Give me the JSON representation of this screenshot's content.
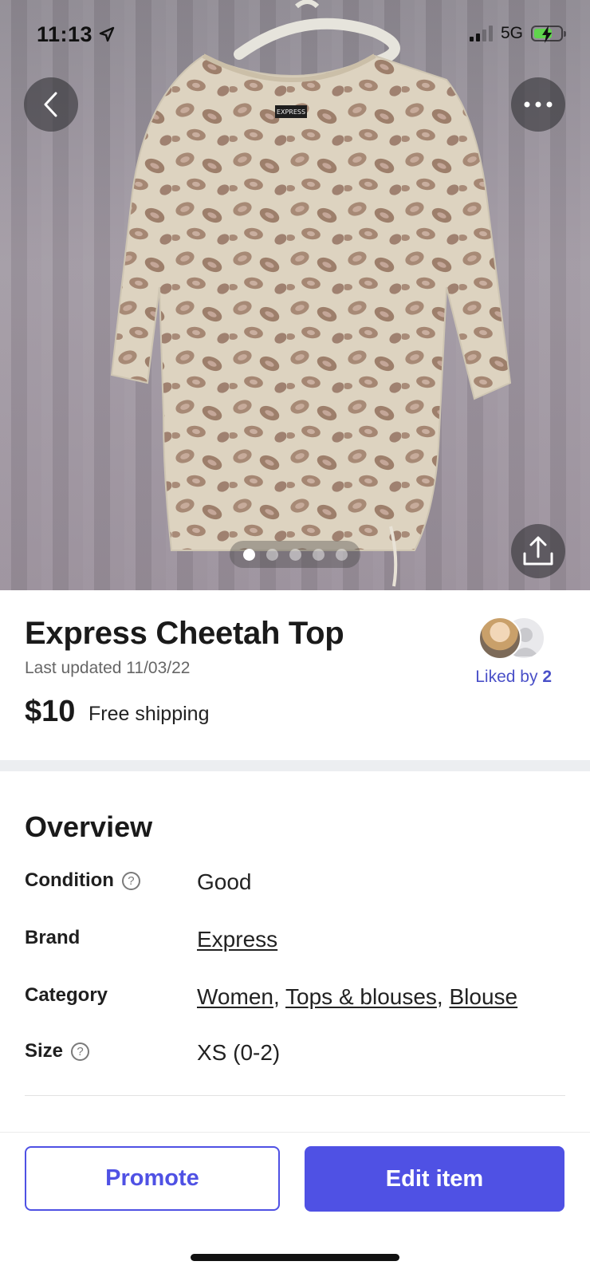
{
  "status_bar": {
    "time": "11:13",
    "network": "5G"
  },
  "hero": {
    "photo_count": 5,
    "active_photo": 1,
    "brand_tag": "EXPRESS"
  },
  "icons": {
    "back": "chevron-left-icon",
    "more": "more-horizontal-icon",
    "share": "share-icon",
    "help": "help-circle-icon"
  },
  "listing": {
    "title": "Express Cheetah Top",
    "last_updated": "Last updated 11/03/22",
    "price": "$10",
    "shipping": "Free shipping",
    "liked_prefix": "Liked by ",
    "liked_count": "2"
  },
  "overview": {
    "title": "Overview",
    "condition": {
      "label": "Condition",
      "value": "Good"
    },
    "brand": {
      "label": "Brand",
      "value": "Express"
    },
    "category": {
      "label": "Category",
      "values": [
        "Women",
        "Tops & blouses",
        "Blouse"
      ],
      "separator": ", "
    },
    "size": {
      "label": "Size",
      "value": "XS (0-2)"
    }
  },
  "actions": {
    "promote": "Promote",
    "edit": "Edit item"
  },
  "colors": {
    "accent": "#4f51e4",
    "liked_text": "#4a50c8",
    "battery": "#5fd44c"
  }
}
